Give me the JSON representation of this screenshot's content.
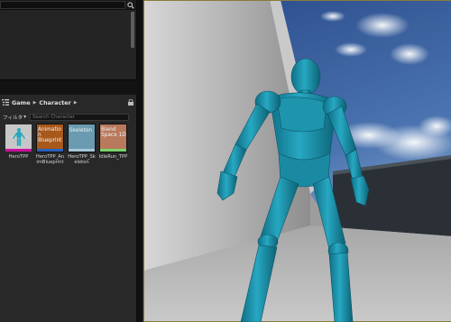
{
  "content_browser": {
    "breadcrumb": [
      "Game",
      "Character"
    ],
    "filter_label": "フィルタ",
    "search_placeholder": "Search Character",
    "assets": [
      {
        "tile_text": "",
        "name": "HeroTPP"
      },
      {
        "tile_text": "Animatio n Blueprint",
        "name": "HeroTPP_An\nimBlueprint"
      },
      {
        "tile_text": "Skeleton",
        "name": "HeroTPP_Sk\neleton"
      },
      {
        "tile_text": "Blend Space 1D",
        "name": "IdleRun_TPP"
      }
    ]
  },
  "icons": {
    "top_search": "search-icon",
    "breadcrumb_folder": "folder-tree-icon",
    "lock": "lock-icon",
    "filter_dropdown": "chevron-down-icon",
    "hero_thumbnail": "character-mesh-icon"
  },
  "colors": {
    "panel_bg": "#282828",
    "mannequin": "#1a9bb6",
    "sky": "#3a5f9c",
    "anim_tile": "#a8581b",
    "skeleton_tile": "#6a9bb0",
    "blendspace_tile": "#b8795c"
  }
}
